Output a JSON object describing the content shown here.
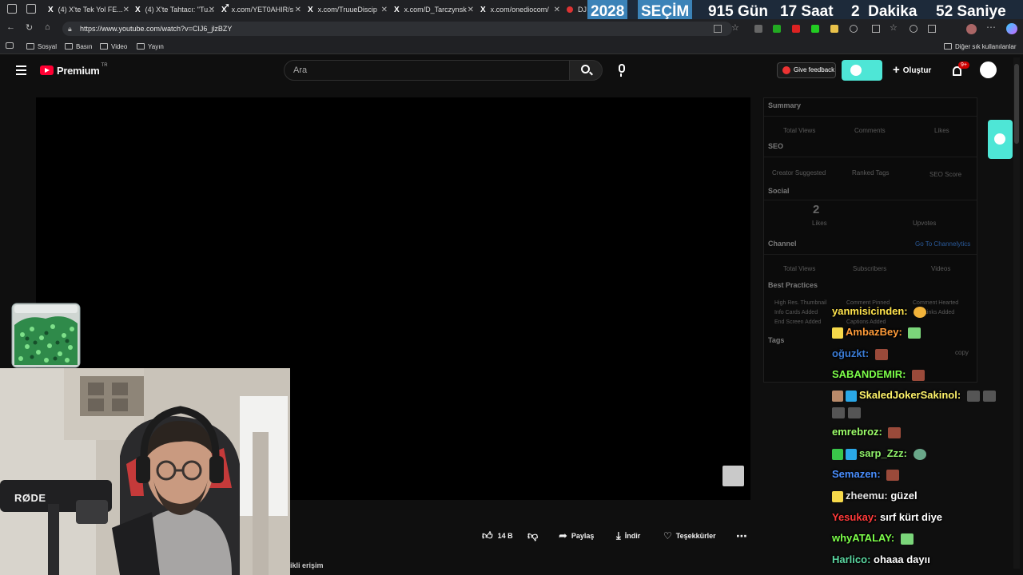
{
  "tabs": [
    {
      "label": "(4) X'te Tek Yol FE..."
    },
    {
      "label": "(4) X'te Tahtacı: \"Tu..."
    },
    {
      "label": "x.com/YET0AHIR/s"
    },
    {
      "label": "x.com/TruueDiscip"
    },
    {
      "label": "x.com/D_Tarczynsk"
    },
    {
      "label": "x.com/onediocom/"
    },
    {
      "label": "DJ"
    }
  ],
  "countdown": {
    "year": "2028",
    "label": "SEÇİM",
    "days": "915 Gün",
    "hours": "17 Saat",
    "minutes": "2  Dakika",
    "seconds": "52 Saniye"
  },
  "address": {
    "url": "https://www.youtube.com/watch?v=CIJ6_jlzBZY"
  },
  "bookmarks": {
    "items": [
      "Sosyal",
      "Basın",
      "Video",
      "Yayın"
    ],
    "other": "Diğer sık kullanılanlar"
  },
  "youtube": {
    "logo_text": "Premium",
    "logo_sup": "TR",
    "search_placeholder": "Ara",
    "feedback_label": "Give feedback",
    "create_label": "Oluştur",
    "notification_count": "9+"
  },
  "actions": {
    "likes": "14 B",
    "share": "Paylaş",
    "download": "İndir",
    "thanks": "Teşekkürler",
    "bottom_text": "ikli erişim"
  },
  "panel": {
    "summary": "Summary",
    "summary_labels": [
      "Total Views",
      "Comments",
      "Likes"
    ],
    "seo": "SEO",
    "seo_labels": [
      "Creator Suggested",
      "Ranked Tags",
      "SEO Score"
    ],
    "social": "Social",
    "social_likes_value": "2",
    "social_likes_label": "Likes",
    "social_upvotes_label": "Upvotes",
    "channel": "Channel",
    "channel_link": "Go To Channelytics",
    "channel_labels": [
      "Total Views",
      "Subscribers",
      "Videos"
    ],
    "best_practices": "Best Practices",
    "bp_items": [
      "High Res. Thumbnail",
      "Comment Pinned",
      "Comment Hearted",
      "Info Cards Added",
      "Links Added",
      "Captions Added",
      "End Screen Added"
    ],
    "tags": "Tags",
    "copy": "copy"
  },
  "chat": [
    {
      "user": "yanmisicinden:",
      "msg": "",
      "color": "#ffe44d"
    },
    {
      "user": "AmbazBey:",
      "msg": "",
      "color": "#ff9c3a"
    },
    {
      "user": "oğuzkt:",
      "msg": "",
      "color": "#3a7bd5"
    },
    {
      "user": "SABANDEMIR:",
      "msg": "",
      "color": "#7dff4a"
    },
    {
      "user": "SkaledJokerSakinol:",
      "msg": "",
      "color": "#fff36a"
    },
    {
      "user": "emrebroz:",
      "msg": "",
      "color": "#9dff6a"
    },
    {
      "user": "sarp_Zzz:",
      "msg": "",
      "color": "#8ff06a"
    },
    {
      "user": "Semazen:",
      "msg": "",
      "color": "#4a8fff"
    },
    {
      "user": "zheemu:",
      "msg": "güzel",
      "color": "#e0e0e0"
    },
    {
      "user": "Yesukay:",
      "msg": "sırf kürt diye",
      "color": "#ff3a3a"
    },
    {
      "user": "whyATALAY:",
      "msg": "",
      "color": "#7dff4a"
    },
    {
      "user": "Harlico:",
      "msg": "ohaaa dayıı",
      "color": "#5ad6a0"
    }
  ],
  "webcam": {
    "mic_brand": "RØDE"
  },
  "colors": {
    "teal": "#4ee6d6",
    "yt_red": "#ff0033",
    "countdown_bg": "#1d2a3a"
  }
}
